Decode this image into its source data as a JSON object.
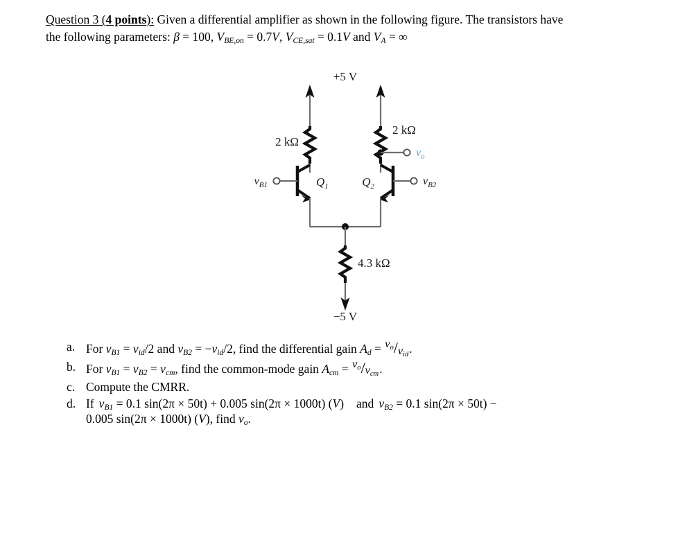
{
  "question": {
    "title_prefix": "Question 3 (",
    "title_bold": "4 points",
    "title_suffix": "):",
    "line1_rest": " Given a differential amplifier as shown in the following figure. The transistors have",
    "line2_lead": "the following parameters: ",
    "beta_symbol": "β",
    "beta_eq": " = 100, ",
    "v1_base": "V",
    "v1_sub": "BE,on",
    "v1_eq": " = 0.7",
    "v1_unit": "V",
    "v1_sep": ", ",
    "v2_base": "V",
    "v2_sub": "CE,sat",
    "v2_eq": " = 0.1",
    "v2_unit": "V",
    "v2_sep": " and ",
    "v3_base": "V",
    "v3_sub": "A",
    "v3_eq": " = ∞"
  },
  "circuit": {
    "supply_top": "+5 V",
    "supply_bottom": "−5 V",
    "rc_left": "2 kΩ",
    "rc_right": "2 kΩ",
    "re": "4.3 kΩ",
    "q1_base": "Q",
    "q1_sub": "1",
    "q2_base": "Q",
    "q2_sub": "2",
    "vb1_base": "v",
    "vb1_sub": "B1",
    "vb2_base": "v",
    "vb2_sub": "B2",
    "vo_base": "v",
    "vo_sub": "o",
    "vo_color": "#4aa3dc",
    "wire_color": "#6e6e6e",
    "ink_color": "#111111"
  },
  "parts": {
    "a": {
      "marker": "a.",
      "t1": "For ",
      "v1_base": "v",
      "v1_sub": "B1",
      "t2": " = ",
      "v2_base": "v",
      "v2_sub": "id",
      "t3": "/2 and ",
      "v3_base": "v",
      "v3_sub": "B2",
      "t4": " = −",
      "v4_base": "v",
      "v4_sub": "id",
      "t5": "/2, find the differential gain ",
      "a_base": "A",
      "a_sub": "d",
      "t6": " = ",
      "num_base": "v",
      "num_sub": "o",
      "den_base": "v",
      "den_sub": "id",
      "t7": "."
    },
    "b": {
      "marker": "b.",
      "t1": "For ",
      "v1_base": "v",
      "v1_sub": "B1",
      "t2": " = ",
      "v2_base": "v",
      "v2_sub": "B2",
      "t3": " = ",
      "v3_base": "v",
      "v3_sub": "cm",
      "t4": ", find the common-mode gain ",
      "a_base": "A",
      "a_sub": "cm",
      "t5": " = ",
      "num_base": "v",
      "num_sub": "o",
      "den_base": "v",
      "den_sub": "cm",
      "t6": "."
    },
    "c": {
      "marker": "c.",
      "text": "Compute the CMRR."
    },
    "d": {
      "marker": "d.",
      "t1": "If",
      "v1_base": "v",
      "v1_sub": "B1",
      "t2": " = 0.1 sin(2π × 50t) + 0.005 sin(2π × 1000t) (",
      "unit1": "V",
      "t3": ")",
      "t4": "and",
      "v2_base": "v",
      "v2_sub": "B2",
      "t5": " = 0.1 sin(2π × 50t) −",
      "t6": "0.005 sin(2π × 1000t) (",
      "unit2": "V",
      "t7": "), find ",
      "vo_base": "v",
      "vo_sub": "o",
      "t8": "."
    }
  }
}
